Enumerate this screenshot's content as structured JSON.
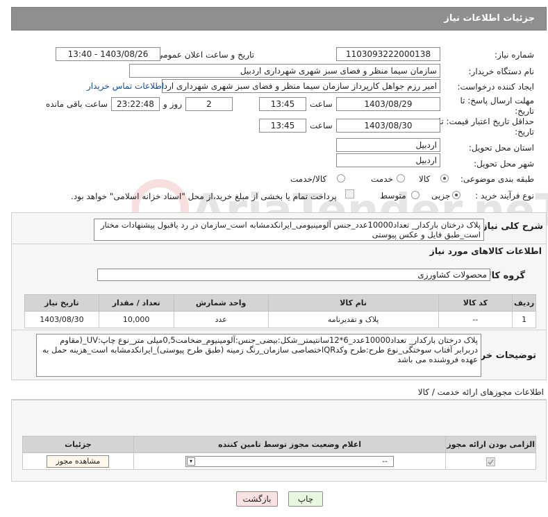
{
  "header": {
    "title": "جزئیات اطلاعات نیاز"
  },
  "form": {
    "need_number_label": "شماره نیاز:",
    "need_number": "1103093222000138",
    "announce_label": "تاریخ و ساعت اعلان عمومی:",
    "announce_value": "1403/08/26 - 13:40",
    "buyer_org_label": "نام دستگاه خریدار:",
    "buyer_org": "سازمان سیما منظر و فضای سبز شهری شهرداری اردبیل",
    "creator_label": "ایجاد کننده درخواست:",
    "creator": "امیر رزم جواهل کارپرداز سازمان سیما منظر و فضای سبز شهری شهرداری اردبیل",
    "contact_link": "اطلاعات تماس خریدار",
    "deadline_label_1": "مهلت ارسال پاسخ: تا",
    "deadline_label_2": "تاریخ:",
    "deadline_date": "1403/08/29",
    "time_label": "ساعت",
    "deadline_time": "13:45",
    "days_value": "2",
    "days_label": "روز و",
    "remaining_time": "23:22:48",
    "remaining_label": "ساعت باقی مانده",
    "validity_label_1": "حداقل تاریخ اعتبار قیمت: تا",
    "validity_label_2": "تاریخ:",
    "validity_date": "1403/08/30",
    "validity_time": "13:45",
    "province_label": "استان محل تحویل:",
    "province": "اردبیل",
    "city_label": "شهر محل تحویل:",
    "city": "اردبیل",
    "category_label": "طبقه بندی موضوعی:",
    "category_options": [
      "کالا",
      "خدمت",
      "کالا/خدمت"
    ],
    "category_selected": "کالا",
    "process_label": "نوع فرآیند خرید :",
    "process_options": [
      "جزیی",
      "متوسط"
    ],
    "process_selected": "جزیی",
    "payment_note": "پرداخت تمام یا بخشی از مبلغ خرید،از محل \"اسناد خزانه اسلامی\" خواهد بود."
  },
  "summary": {
    "label": "شرح کلی نیاز:",
    "text": "پلاک درختان بارکدار_ تعداد10000عدد_جنس آلومینیومی_ایرانکدمشابه است_سازمان در رد یاقبول پیشنهادات مختار است_طبق فایل و عکس پیوستی"
  },
  "goods": {
    "section_title": "اطلاعات کالاهای مورد نیاز",
    "group_label": "گروه کالا:",
    "group_value": "محصولات کشاورزی",
    "columns": [
      "ردیف",
      "کد کالا",
      "نام کالا",
      "واحد شمارش",
      "تعداد / مقدار",
      "تاریخ نیاز"
    ],
    "rows": [
      {
        "idx": "1",
        "code": "--",
        "name": "پلاک و تقدیرنامه",
        "unit": "عدد",
        "qty": "10,000",
        "date": "1403/08/30"
      }
    ]
  },
  "buyer_notes": {
    "label": "توضیحات خریدار:",
    "text": "پلاک درختان بارکدار_ تعداد10000عدد_6*12سانتیمتر_شکل:بیضی_جنس:آلومینیوم_ضخامت0,5میلی متر_نوع چاپ:UV_(مقاوم دربرابر آفتاب سوختگی_نوع طرح:طرح وکدQRاختصاصی سازمان_رنگ زمینه (طبق طرح پیوستی)_ایرانکدمشابه است_هزینه حمل به عهده فروشنده می باشد"
  },
  "permits": {
    "title": "اطلاعات مجوزهای ارائه خدمت / کالا",
    "columns": [
      "الزامی بودن ارائه مجوز",
      "اعلام وضعیت مجوز توسط تامین کننده",
      "جزئیات"
    ],
    "select_value": "--",
    "view_button": "مشاهده مجوز"
  },
  "actions": {
    "print": "چاپ",
    "back": "بازگشت"
  },
  "watermark": "AriaTender.neT",
  "colors": {
    "header_bg": "#8f8f8f",
    "link": "#0d4ea6",
    "print_bg": "#e9f7e0",
    "back_bg": "#fbe2e2"
  }
}
